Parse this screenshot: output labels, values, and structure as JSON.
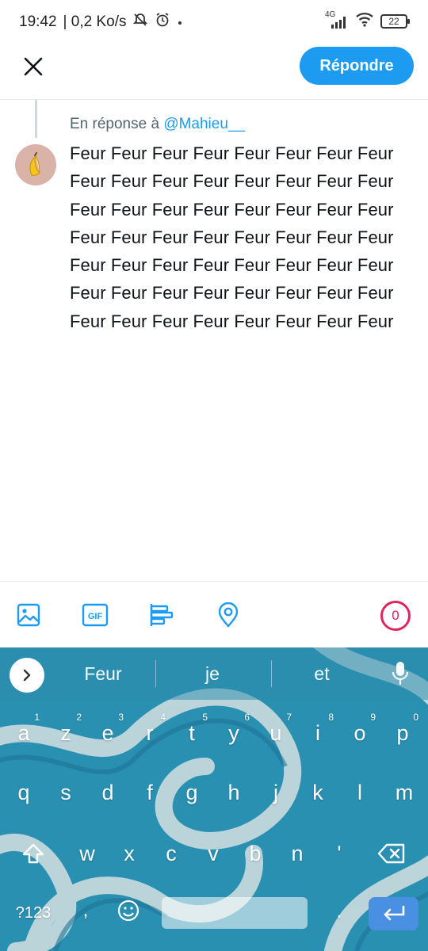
{
  "status": {
    "time": "19:42",
    "speed": "| 0,2 Ko/s",
    "network": "4G",
    "battery": "22"
  },
  "header": {
    "close_icon": "close-icon",
    "reply_label": "Répondre"
  },
  "compose": {
    "reply_prefix": "En réponse à",
    "reply_handle": "@Mahieu__",
    "avatar_icon": "banana-icon",
    "text": "Feur Feur Feur Feur Feur Feur Feur Feur Feur Feur Feur Feur Feur Feur Feur Feur Feur Feur Feur Feur Feur Feur Feur Feur Feur Feur Feur Feur Feur Feur Feur Feur Feur Feur Feur Feur Feur Feur Feur Feur Feur Feur Feur Feur Feur Feur Feur Feur Feur Feur Feur Feur Feur Feur Feur Feur"
  },
  "toolbar": {
    "tools": [
      "image-icon",
      "gif-icon",
      "poll-icon",
      "location-icon"
    ],
    "char_counter": "0",
    "counter_color": "#e0245e"
  },
  "keyboard": {
    "suggestions": [
      "Feur",
      "je",
      "et"
    ],
    "row1": [
      {
        "k": "a",
        "n": "1"
      },
      {
        "k": "z",
        "n": "2"
      },
      {
        "k": "e",
        "n": "3"
      },
      {
        "k": "r",
        "n": "4"
      },
      {
        "k": "t",
        "n": "5"
      },
      {
        "k": "y",
        "n": "6"
      },
      {
        "k": "u",
        "n": "7"
      },
      {
        "k": "i",
        "n": "8"
      },
      {
        "k": "o",
        "n": "9"
      },
      {
        "k": "p",
        "n": "0"
      }
    ],
    "row2": [
      "q",
      "s",
      "d",
      "f",
      "g",
      "h",
      "j",
      "k",
      "l",
      "m"
    ],
    "row3": [
      "w",
      "x",
      "c",
      "v",
      "b",
      "n",
      "'"
    ],
    "bottom": {
      "symbols": "?123",
      "comma": ",",
      "period": "."
    }
  },
  "colors": {
    "accent": "#1d9bf0",
    "enter_key": "#4a90e2"
  }
}
